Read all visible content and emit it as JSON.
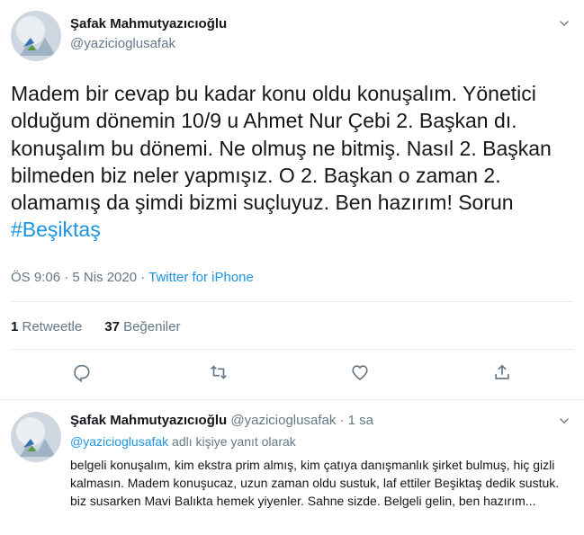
{
  "tweet": {
    "author_name": "Şafak Mahmutyazıcıoğlu",
    "author_handle": "@yazicioglusafak",
    "text": "Madem bir cevap bu kadar konu oldu konuşalım. Yönetici olduğum dönemin 10/9 u Ahmet Nur Çebi  2. Başkan dı. konuşalım bu dönemi. Ne olmuş ne bitmiş. Nasıl 2. Başkan bilmeden biz neler yapmışız. O 2. Başkan o zaman 2. olamamış da şimdi bizmi suçluyuz. Ben hazırım! Sorun ",
    "hashtag": "#Beşiktaş",
    "timestamp": "ÖS 9:06 · 5 Nis 2020",
    "separator": " · ",
    "source": "Twitter for iPhone",
    "retweet_count": "1",
    "retweet_label": " Retweetle",
    "like_count": "37",
    "like_label": " Beğeniler"
  },
  "icons": {
    "caret": "chevron-down-icon",
    "reply": "reply-icon",
    "retweet": "retweet-icon",
    "like": "heart-icon",
    "share": "share-icon"
  },
  "reply": {
    "author_name": "Şafak Mahmutyazıcıoğlu",
    "author_handle": "@yazicioglusafak",
    "time": " · 1 sa",
    "replying_to_handle": "@yazicioglusafak",
    "replying_to_suffix": " adlı kişiye yanıt olarak",
    "text": "belgeli konuşalım, kim ekstra prim almış, kim çatıya danışmanlık şirket bulmuş, hiç gizli kalmasın. Madem konuşucaz, uzun zaman oldu sustuk, laf ettiler Beşiktaş dedik sustuk. biz susarken Mavi Balıkta hemek yiyenler. Sahne sizde. Belgeli gelin, ben hazırım..."
  },
  "colors": {
    "link": "#1b95e0",
    "secondary_text": "#657786",
    "primary_text": "#14171a",
    "divider": "#e6ecf0"
  }
}
